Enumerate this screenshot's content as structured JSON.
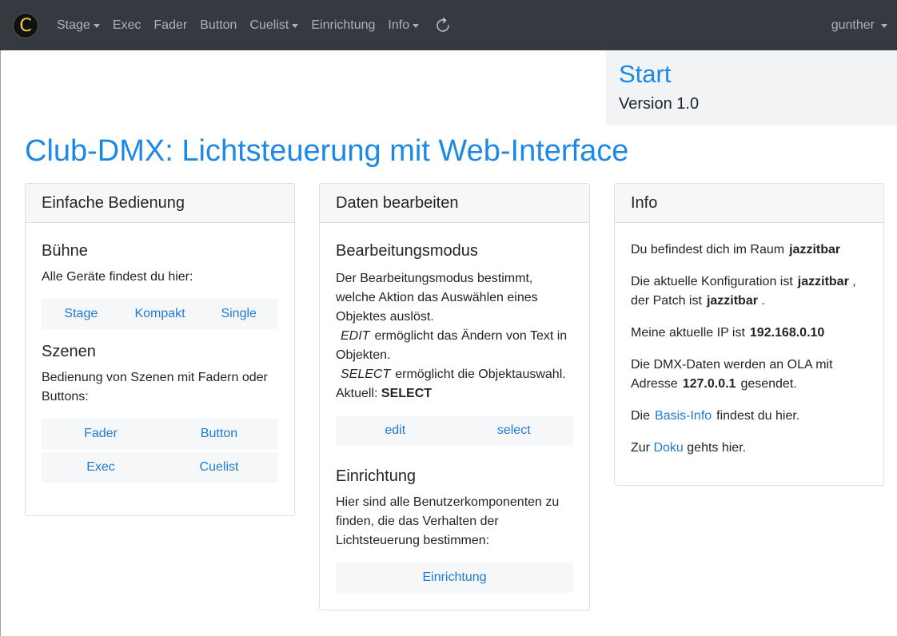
{
  "navbar": {
    "brand_letter": "C",
    "items": [
      {
        "label": "Stage",
        "dropdown": true
      },
      {
        "label": "Exec",
        "dropdown": false
      },
      {
        "label": "Fader",
        "dropdown": false
      },
      {
        "label": "Button",
        "dropdown": false
      },
      {
        "label": "Cuelist",
        "dropdown": true
      },
      {
        "label": "Einrichtung",
        "dropdown": false
      },
      {
        "label": "Info",
        "dropdown": true
      }
    ],
    "refresh_icon": "refresh-icon",
    "user": "gunther"
  },
  "jumbotron": {
    "title": "Start",
    "version": "Version 1.0"
  },
  "page_title": "Club-DMX: Lichtsteuerung mit Web-Interface",
  "cards": {
    "simple": {
      "header": "Einfache Bedienung",
      "stage_heading": "Bühne",
      "stage_text": "Alle Geräte findest du hier:",
      "stage_links": [
        "Stage",
        "Kompakt",
        "Single"
      ],
      "scenes_heading": "Szenen",
      "scenes_text": "Bedienung von Szenen mit Fadern oder Buttons:",
      "scene_links_row1": [
        "Fader",
        "Button"
      ],
      "scene_links_row2": [
        "Exec",
        "Cuelist"
      ]
    },
    "edit": {
      "header": "Daten bearbeiten",
      "mode_heading": "Bearbeitungsmodus",
      "mode_text": "Der Bearbeitungsmodus bestimmt, welche Aktion das Auswählen eines Objektes auslöst.",
      "edit_keyword": "EDIT",
      "edit_desc": "ermöglicht das Ändern von Text in Objekten.",
      "select_keyword": "SELECT",
      "select_desc": "ermöglicht die Objektauswahl.",
      "current_label": "Aktuell:",
      "current_value": "SELECT",
      "mode_buttons": [
        "edit",
        "select"
      ],
      "setup_heading": "Einrichtung",
      "setup_text": "Hier sind alle Benutzerkomponenten zu finden, die das Verhalten der Lichtsteuerung bestimmen:",
      "setup_button": "Einrichtung"
    },
    "info": {
      "header": "Info",
      "room_text": "Du befindest dich im Raum",
      "room_value": "jazzitbar",
      "config_text": "Die aktuelle Konfiguration ist",
      "config_value": "jazzitbar",
      "config_sep": ",",
      "patch_text": "der Patch ist",
      "patch_value": "jazzitbar",
      "patch_end": ".",
      "ip_text": "Meine aktuelle IP ist",
      "ip_value": "192.168.0.10",
      "dmx_text": "Die DMX-Daten werden an OLA mit Adresse",
      "dmx_value": "127.0.0.1",
      "dmx_end": "gesendet.",
      "basis_pre": "Die",
      "basis_link": "Basis-Info",
      "basis_post": "findest du hier.",
      "doku_pre": "Zur",
      "doku_link": "Doku",
      "doku_post": "gehts hier."
    }
  }
}
